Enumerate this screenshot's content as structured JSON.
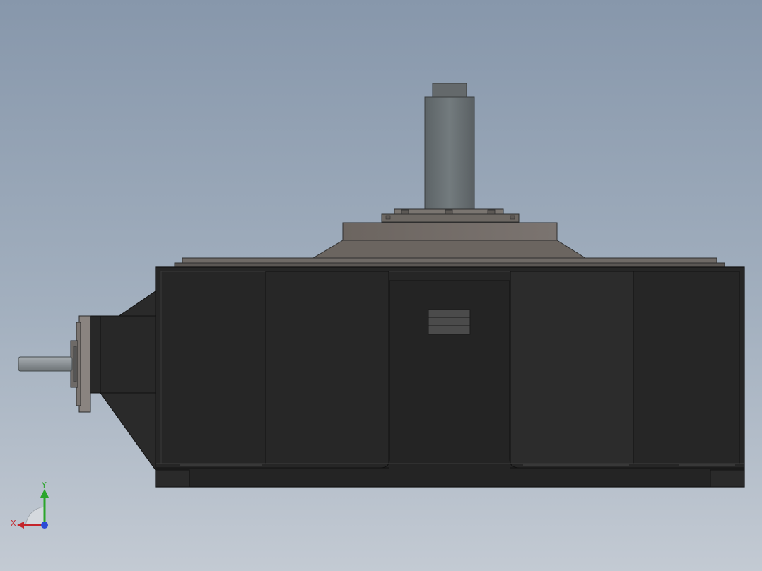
{
  "colors": {
    "background_top": "#8797ab",
    "background_bottom": "#c3cad3",
    "housing": "#252525",
    "cover": "#706a65",
    "shaft": "#6b7275",
    "axis_x": "#c4252b",
    "axis_y": "#2ba52b",
    "axis_z": "#2c4bd6"
  },
  "triad": {
    "x_label": "X",
    "y_label": "Y"
  }
}
